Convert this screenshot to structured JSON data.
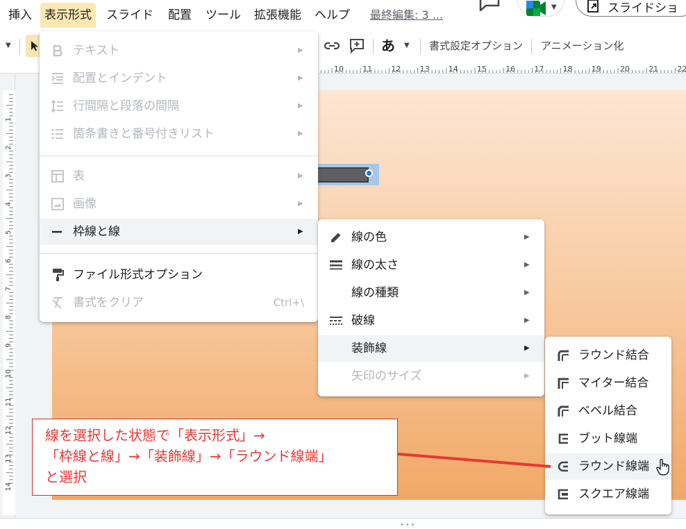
{
  "menubar": {
    "items": [
      "挿入",
      "表示形式",
      "スライド",
      "配置",
      "ツール",
      "拡張機能",
      "ヘルプ"
    ],
    "last_edit": "最終編集: 3 ...",
    "slideshow_label": "スライドショ"
  },
  "toolbar": {
    "font_char": "あ",
    "format_options": "書式設定オプション",
    "animate": "アニメーション化"
  },
  "ruler": {
    "top_numbers": [
      "10",
      "11",
      "12",
      "13",
      "14",
      "15",
      "16",
      "17",
      "18",
      "19",
      "20",
      "21",
      "22"
    ],
    "left_numbers": [
      "1",
      "2",
      "3",
      "4",
      "5",
      "6",
      "7",
      "8",
      "9",
      "10",
      "11",
      "12",
      "13",
      "14"
    ]
  },
  "format_menu": {
    "items": [
      {
        "label": "テキスト",
        "disabled": true,
        "icon": "bold-icon"
      },
      {
        "label": "配置とインデント",
        "disabled": true,
        "icon": "indent-icon"
      },
      {
        "label": "行間隔と段落の間隔",
        "disabled": true,
        "icon": "line-spacing-icon"
      },
      {
        "label": "箇条書きと番号付きリスト",
        "disabled": true,
        "icon": "list-icon"
      },
      {
        "label": "表",
        "disabled": true,
        "icon": "table-icon"
      },
      {
        "label": "画像",
        "disabled": true,
        "icon": "image-icon"
      },
      {
        "label": "枠線と線",
        "disabled": false,
        "icon": "border-line-icon"
      },
      {
        "label": "ファイル形式オプション",
        "disabled": false,
        "icon": "paint-roller-icon"
      },
      {
        "label": "書式をクリア",
        "disabled": true,
        "icon": "clear-format-icon",
        "shortcut": "Ctrl+\\"
      }
    ]
  },
  "borders_submenu": {
    "items": [
      {
        "label": "線の色",
        "icon": "pencil-icon"
      },
      {
        "label": "線の太さ",
        "icon": "line-weight-icon"
      },
      {
        "label": "線の種類",
        "icon": ""
      },
      {
        "label": "破線",
        "icon": "dash-icon"
      },
      {
        "label": "装飾線",
        "icon": ""
      },
      {
        "label": "矢印のサイズ",
        "icon": "",
        "disabled": true
      }
    ]
  },
  "decoration_submenu": {
    "items": [
      {
        "label": "ラウンド結合",
        "icon": "round-join-icon"
      },
      {
        "label": "マイター結合",
        "icon": "miter-join-icon"
      },
      {
        "label": "ベベル結合",
        "icon": "bevel-join-icon"
      },
      {
        "label": "ブット線端",
        "icon": "butt-cap-icon"
      },
      {
        "label": "ラウンド線端",
        "icon": "round-cap-icon"
      },
      {
        "label": "スクエア線端",
        "icon": "square-cap-icon"
      }
    ]
  },
  "annotation": {
    "text": "線を選択した状態で「表示形式」→\n「枠線と線」→「装飾線」→「ラウンド線端」\nと選択"
  },
  "colors": {
    "accent": "#1a73e8",
    "menu_highlight": "#fce8b2",
    "annotation": "#e53935"
  }
}
